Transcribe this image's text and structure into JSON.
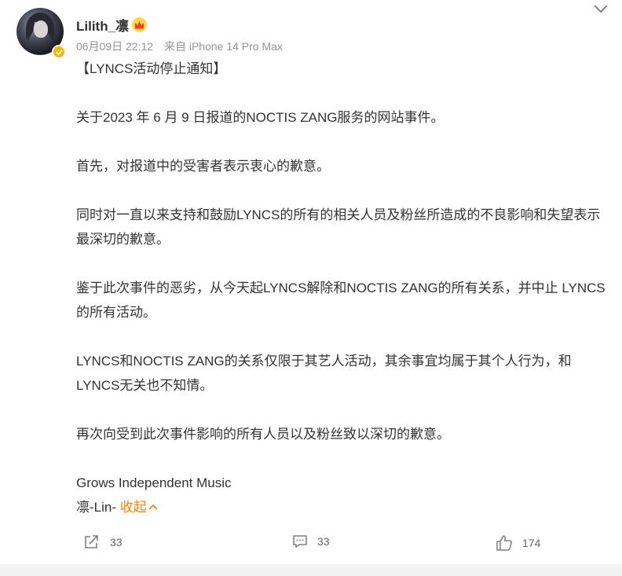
{
  "post": {
    "username": "Lilith_凛",
    "timestamp": "06月09日 22:12",
    "source": "来自 iPhone 14 Pro Max",
    "badge_icon": "crown-badge-icon",
    "verified_icon": "verified-badge-icon",
    "paragraphs": [
      "【LYNCS活动停止通知】",
      "关于2023 年 6 月 9 日报道的NOCTIS ZANG服务的网站事件。",
      "首先，对报道中的受害者表示衷心的歉意。",
      "同时对一直以来支持和鼓励LYNCS的所有的相关人员及粉丝所造成的不良影响和失望表示最深切的歉意。",
      "鉴于此次事件的恶劣，从今天起LYNCS解除和NOCTIS ZANG的所有关系，并中止 LYNCS 的所有活动。",
      "LYNCS和NOCTIS ZANG的关系仅限于其艺人活动，其余事宜均属于其个人行为，和LYNCS无关也不知情。",
      "再次向受到此次事件影响的所有人员以及粉丝致以深切的歉意。"
    ],
    "signature_line1": "Grows Independent Music",
    "signature_line2": "凛-Lin-",
    "collapse_label": "收起",
    "accent_color": "#ff8200"
  },
  "actions": {
    "share_count": "33",
    "comment_count": "33",
    "like_count": "174"
  }
}
